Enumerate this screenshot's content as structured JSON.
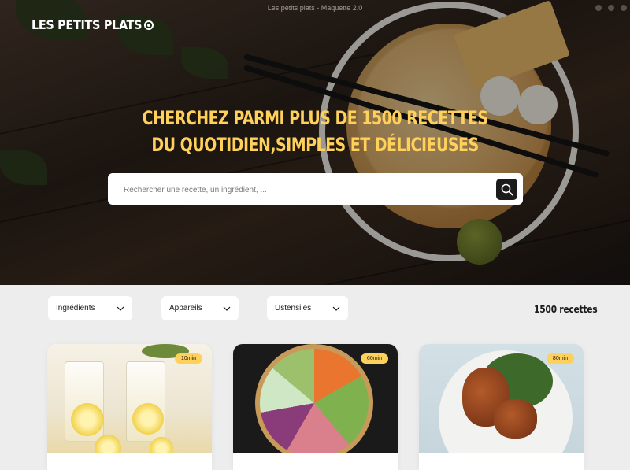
{
  "window": {
    "title": "Les petits plats - Maquette 2.0"
  },
  "header": {
    "logo_text": "LES PETITS PLATS",
    "logo_icon": "circle-dot-icon"
  },
  "hero": {
    "headline_line1": "CHERCHEZ PARMI PLUS DE 1500 RECETTES",
    "headline_line2": "DU QUOTIDIEN,SIMPLES ET DÉLICIEUSES",
    "search_placeholder": "Rechercher une recette, un ingrédient, ...",
    "search_icon": "search-icon"
  },
  "filters": [
    {
      "label": "Ingrédients",
      "icon": "chevron-down-icon"
    },
    {
      "label": "Appareils",
      "icon": "chevron-down-icon"
    },
    {
      "label": "Ustensiles",
      "icon": "chevron-down-icon"
    }
  ],
  "recipe_count": "1500 recettes",
  "cards": [
    {
      "time": "10min"
    },
    {
      "time": "60min"
    },
    {
      "time": "80min"
    }
  ],
  "colors": {
    "accent": "#ffd15b",
    "dark": "#1b1b1b",
    "background": "#ededed"
  }
}
